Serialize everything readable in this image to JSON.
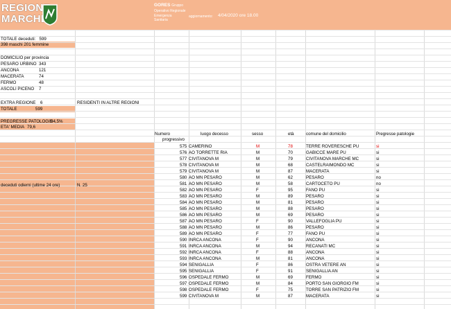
{
  "header": {
    "logo_line1": "REGIONE",
    "logo_line2": "MARCHE",
    "org_title": "GORES",
    "org_suffix": "Gruppo",
    "org_lines": [
      "Operativo Regionale",
      "Emergenza",
      "Sanitaria"
    ],
    "update_label": "aggiornamento:",
    "update_value": "4/04/2020 ore 18.00"
  },
  "summary": {
    "total_label": "TOTALE deceduti:",
    "total_value": "599",
    "gender_split": "398 maschi  201 femmine",
    "province_heading": "DOMICILIO per provincia",
    "provinces": [
      {
        "name": "PESARO  URBINO",
        "value": "343"
      },
      {
        "name": "ANCONA",
        "value": "121"
      },
      {
        "name": "MACERATA",
        "value": "74"
      },
      {
        "name": "FERMO",
        "value": "48"
      },
      {
        "name": "ASCOLI PICENO",
        "value": "7"
      }
    ],
    "extra_label": "EXTRA REGIONE",
    "extra_value": "6",
    "extra_note": "RESIDENTI IN ALTRE REGIONI",
    "totale_label": "TOTALE",
    "totale_value": "599",
    "patologie_label": "PREGRESSE PATOLOGIE",
    "patologie_value": "94,5%",
    "eta_label": "ETA' MEDIA",
    "eta_value": "79,6",
    "oggi_label": "deceduti odierni (ultime 24 ore)",
    "oggi_value": "N. 25"
  },
  "table": {
    "headers": {
      "numero": "Numero",
      "progressivo": "progressivo",
      "luogo": "luogo decesso",
      "sesso": "sesso",
      "eta": "età",
      "comune": "comune del domicilio",
      "patologie": "Pregresse patologie"
    },
    "rows": [
      {
        "n": "575",
        "luogo": "CAMERINO",
        "sesso": "M",
        "eta": "78",
        "comune": "TERRE ROVERESCHE PU",
        "pat": "si",
        "highlight": true
      },
      {
        "n": "576",
        "luogo": "AO TORRETTE RIA",
        "sesso": "M",
        "eta": "70",
        "comune": "GABICCE MARE PU",
        "pat": "si"
      },
      {
        "n": "577",
        "luogo": "CIVITANOVA M",
        "sesso": "M",
        "eta": "79",
        "comune": "CIVITANOVA MARCHE MC",
        "pat": "si"
      },
      {
        "n": "578",
        "luogo": "CIVITANOVA M",
        "sesso": "M",
        "eta": "68",
        "comune": "CASTELRAIMONDO MC",
        "pat": "si"
      },
      {
        "n": "579",
        "luogo": "CIVITANOVA M",
        "sesso": "M",
        "eta": "87",
        "comune": "MACERATA",
        "pat": "si"
      },
      {
        "n": "580",
        "luogo": "AO MN PESARO",
        "sesso": "M",
        "eta": "62",
        "comune": "PESARO",
        "pat": "no"
      },
      {
        "n": "581",
        "luogo": "AO MN PESARO",
        "sesso": "M",
        "eta": "58",
        "comune": "CARTOCETO PU",
        "pat": "no"
      },
      {
        "n": "582",
        "luogo": "AO MN PESARO",
        "sesso": "F",
        "eta": "95",
        "comune": "FANO PU",
        "pat": "si"
      },
      {
        "n": "583",
        "luogo": "AO MN PESARO",
        "sesso": "M",
        "eta": "89",
        "comune": "PESARO",
        "pat": "si"
      },
      {
        "n": "584",
        "luogo": "AO MN PESARO",
        "sesso": "M",
        "eta": "81",
        "comune": "PESARO",
        "pat": "si"
      },
      {
        "n": "585",
        "luogo": "AO MN PESARO",
        "sesso": "M",
        "eta": "88",
        "comune": "PESARO",
        "pat": "si"
      },
      {
        "n": "586",
        "luogo": "AO MN PESARO",
        "sesso": "M",
        "eta": "69",
        "comune": "PESARO",
        "pat": "si"
      },
      {
        "n": "587",
        "luogo": "AO MN PESARO",
        "sesso": "F",
        "eta": "90",
        "comune": "VALLEFOGLIA PU",
        "pat": "si"
      },
      {
        "n": "588",
        "luogo": "AO MN PESARO",
        "sesso": "M",
        "eta": "86",
        "comune": "PESARO",
        "pat": "si"
      },
      {
        "n": "589",
        "luogo": "AO MN PESARO",
        "sesso": "F",
        "eta": "77",
        "comune": "FANO PU",
        "pat": "si"
      },
      {
        "n": "590",
        "luogo": "INRCA ANCONA",
        "sesso": "F",
        "eta": "90",
        "comune": "ANCONA",
        "pat": "si"
      },
      {
        "n": "591",
        "luogo": "INRCA ANCONA",
        "sesso": "M",
        "eta": "94",
        "comune": "RECANATI MC",
        "pat": "si"
      },
      {
        "n": "592",
        "luogo": "INRCA ANCONA",
        "sesso": "F",
        "eta": "88",
        "comune": "ANCONA",
        "pat": "si"
      },
      {
        "n": "593",
        "luogo": "INRCA ANCONA",
        "sesso": "M",
        "eta": "81",
        "comune": "ANCONA",
        "pat": "si"
      },
      {
        "n": "594",
        "luogo": "SENIGALLIA",
        "sesso": "F",
        "eta": "86",
        "comune": "OSTRA VETERE AN",
        "pat": "si"
      },
      {
        "n": "595",
        "luogo": "SENIGALLIA",
        "sesso": "F",
        "eta": "91",
        "comune": "SENIGALLIA AN",
        "pat": "si"
      },
      {
        "n": "596",
        "luogo": "OSPEDALE FERMO",
        "sesso": "M",
        "eta": "69",
        "comune": "FERMO",
        "pat": "si"
      },
      {
        "n": "597",
        "luogo": "OSPEDALE FERMO",
        "sesso": "M",
        "eta": "84",
        "comune": "PORTO SAN GIORGIO FM",
        "pat": "si"
      },
      {
        "n": "598",
        "luogo": "OSPEDALE FERMO",
        "sesso": "F",
        "eta": "75",
        "comune": "TORRE SAN PATRIZIO FM",
        "pat": "si"
      },
      {
        "n": "599",
        "luogo": "CIVITANOVA M",
        "sesso": "M",
        "eta": "87",
        "comune": "MACERATA",
        "pat": "si"
      }
    ]
  },
  "colors": {
    "header_bg": "#f6b68f",
    "highlight_red": "#e00000",
    "grid": "#d9d9d9"
  }
}
